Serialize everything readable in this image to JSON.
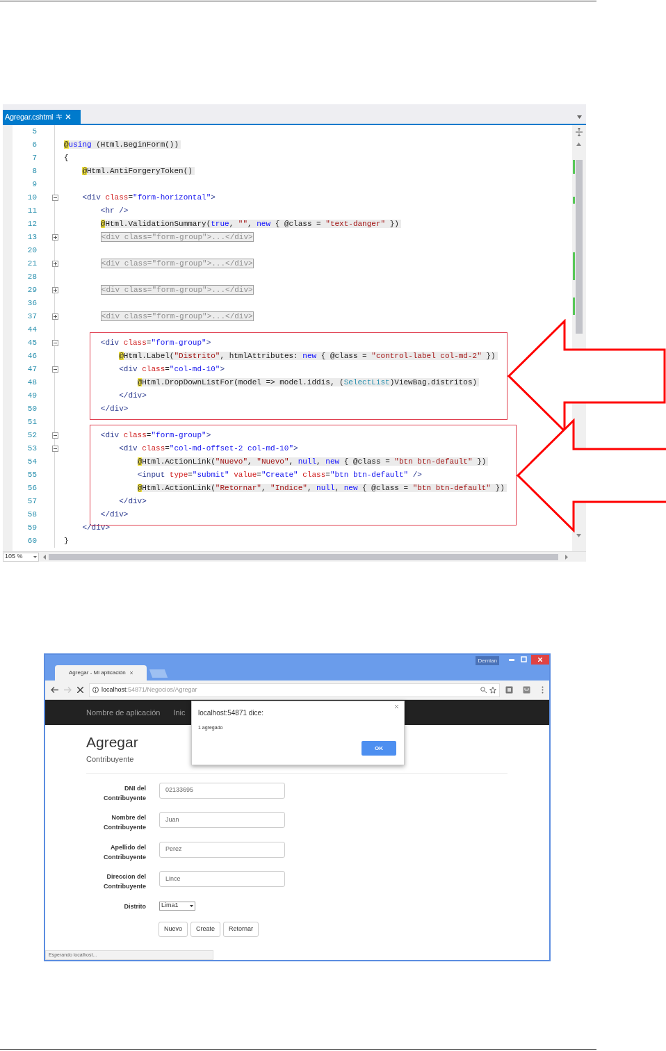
{
  "editor": {
    "tab_title": "Agregar.cshtml",
    "code_blocks": [
      {
        "lines": [
          {
            "number": "5"
          },
          {
            "number": "6",
            "razor": true,
            "tokens": [
              {
                "kind": "at",
                "text": "@"
              },
              {
                "kind": "keyword",
                "text": "using"
              },
              {
                "kind": "plain",
                "text": " (Html.BeginForm())"
              }
            ]
          },
          {
            "number": "7",
            "tokens": [
              {
                "kind": "plain",
                "text": "{"
              }
            ]
          },
          {
            "number": "8",
            "razor": true,
            "tokens": [
              {
                "kind": "at",
                "text": "    @"
              },
              {
                "kind": "plain",
                "text": "Html.AntiForgeryToken()"
              }
            ]
          },
          {
            "number": "9"
          },
          {
            "number": "10",
            "expanded": true,
            "tokens": [
              {
                "kind": "tag",
                "text": "    <div"
              },
              {
                "kind": "attr",
                "text": " class"
              },
              {
                "kind": "plain",
                "text": "="
              },
              {
                "kind": "value",
                "text": "\"form-horizontal\""
              },
              {
                "kind": "tag",
                "text": ">"
              }
            ]
          },
          {
            "number": "11",
            "tokens": [
              {
                "kind": "tag",
                "text": "        <hr />"
              }
            ]
          },
          {
            "number": "12",
            "razor": true,
            "tokens": [
              {
                "kind": "at",
                "text": "        @"
              },
              {
                "kind": "plain",
                "text": "Html.ValidationSummary("
              },
              {
                "kind": "keyword",
                "text": "true"
              },
              {
                "kind": "plain",
                "text": ", "
              },
              {
                "kind": "string",
                "text": "\"\""
              },
              {
                "kind": "plain",
                "text": ", "
              },
              {
                "kind": "keyword",
                "text": "new"
              },
              {
                "kind": "plain",
                "text": " { @class = "
              },
              {
                "kind": "string",
                "text": "\"text-danger\""
              },
              {
                "kind": "plain",
                "text": " })"
              }
            ]
          },
          {
            "number": "13",
            "expanded": false,
            "tokens": [
              {
                "kind": "collapsed",
                "text": "        <div class=\"form-group\">...</div>"
              }
            ]
          },
          {
            "number": "20"
          },
          {
            "number": "21",
            "expanded": false,
            "tokens": [
              {
                "kind": "collapsed",
                "text": "        <div class=\"form-group\">...</div>"
              }
            ]
          },
          {
            "number": "28"
          },
          {
            "number": "29",
            "expanded": false,
            "tokens": [
              {
                "kind": "collapsed",
                "text": "        <div class=\"form-group\">...</div>"
              }
            ]
          },
          {
            "number": "36"
          },
          {
            "number": "37",
            "expanded": false,
            "tokens": [
              {
                "kind": "collapsed",
                "text": "        <div class=\"form-group\">...</div>"
              }
            ]
          },
          {
            "number": "44"
          }
        ]
      },
      {
        "boxed": true,
        "lines": [
          {
            "number": "45",
            "expanded": true,
            "tokens": [
              {
                "kind": "tag",
                "text": "        <div"
              },
              {
                "kind": "attr",
                "text": " class"
              },
              {
                "kind": "plain",
                "text": "="
              },
              {
                "kind": "value",
                "text": "\"form-group\""
              },
              {
                "kind": "tag",
                "text": ">"
              }
            ]
          },
          {
            "number": "46",
            "razor": true,
            "tokens": [
              {
                "kind": "at",
                "text": "            @"
              },
              {
                "kind": "plain",
                "text": "Html.Label("
              },
              {
                "kind": "string",
                "text": "\"Distrito\""
              },
              {
                "kind": "plain",
                "text": ", htmlAttributes: "
              },
              {
                "kind": "keyword",
                "text": "new"
              },
              {
                "kind": "plain",
                "text": " { @class = "
              },
              {
                "kind": "string",
                "text": "\"control-label col-md-2\""
              },
              {
                "kind": "plain",
                "text": " })"
              }
            ]
          },
          {
            "number": "47",
            "expanded": true,
            "tokens": [
              {
                "kind": "tag",
                "text": "            <div"
              },
              {
                "kind": "attr",
                "text": " class"
              },
              {
                "kind": "plain",
                "text": "="
              },
              {
                "kind": "value",
                "text": "\"col-md-10\""
              },
              {
                "kind": "tag",
                "text": ">"
              }
            ]
          },
          {
            "number": "48",
            "razor": true,
            "tokens": [
              {
                "kind": "at",
                "text": "                @"
              },
              {
                "kind": "plain",
                "text": "Html.DropDownListFor(model => model.iddis, ("
              },
              {
                "kind": "type",
                "text": "SelectList"
              },
              {
                "kind": "plain",
                "text": ")ViewBag.distritos)"
              }
            ]
          },
          {
            "number": "49",
            "tokens": [
              {
                "kind": "tag",
                "text": "            </div>"
              }
            ]
          },
          {
            "number": "50",
            "tokens": [
              {
                "kind": "tag",
                "text": "        </div>"
              }
            ]
          }
        ]
      },
      {
        "lines": [
          {
            "number": "51"
          }
        ]
      },
      {
        "boxed": true,
        "lines": [
          {
            "number": "52",
            "expanded": true,
            "tokens": [
              {
                "kind": "tag",
                "text": "        <div"
              },
              {
                "kind": "attr",
                "text": " class"
              },
              {
                "kind": "plain",
                "text": "="
              },
              {
                "kind": "value",
                "text": "\"form-group\""
              },
              {
                "kind": "tag",
                "text": ">"
              }
            ]
          },
          {
            "number": "53",
            "expanded": true,
            "tokens": [
              {
                "kind": "tag",
                "text": "            <div"
              },
              {
                "kind": "attr",
                "text": " class"
              },
              {
                "kind": "plain",
                "text": "="
              },
              {
                "kind": "value",
                "text": "\"col-md-offset-2 col-md-10\""
              },
              {
                "kind": "tag",
                "text": ">"
              }
            ]
          },
          {
            "number": "54",
            "razor": true,
            "tokens": [
              {
                "kind": "at",
                "text": "                @"
              },
              {
                "kind": "plain",
                "text": "Html.ActionLink("
              },
              {
                "kind": "string",
                "text": "\"Nuevo\""
              },
              {
                "kind": "plain",
                "text": ", "
              },
              {
                "kind": "string",
                "text": "\"Nuevo\""
              },
              {
                "kind": "plain",
                "text": ", "
              },
              {
                "kind": "keyword",
                "text": "null"
              },
              {
                "kind": "plain",
                "text": ", "
              },
              {
                "kind": "keyword",
                "text": "new"
              },
              {
                "kind": "plain",
                "text": " { @class = "
              },
              {
                "kind": "string",
                "text": "\"btn btn-default\""
              },
              {
                "kind": "plain",
                "text": " })"
              }
            ]
          },
          {
            "number": "55",
            "tokens": [
              {
                "kind": "tag",
                "text": "                <input"
              },
              {
                "kind": "attr",
                "text": " type"
              },
              {
                "kind": "plain",
                "text": "="
              },
              {
                "kind": "value",
                "text": "\"submit\""
              },
              {
                "kind": "attr",
                "text": " value"
              },
              {
                "kind": "plain",
                "text": "="
              },
              {
                "kind": "value",
                "text": "\"Create\""
              },
              {
                "kind": "attr",
                "text": " class"
              },
              {
                "kind": "plain",
                "text": "="
              },
              {
                "kind": "value",
                "text": "\"btn btn-default\""
              },
              {
                "kind": "tag",
                "text": " />"
              }
            ]
          },
          {
            "number": "56",
            "razor": true,
            "tokens": [
              {
                "kind": "at",
                "text": "                @"
              },
              {
                "kind": "plain",
                "text": "Html.ActionLink("
              },
              {
                "kind": "string",
                "text": "\"Retornar\""
              },
              {
                "kind": "plain",
                "text": ", "
              },
              {
                "kind": "string",
                "text": "\"Indice\""
              },
              {
                "kind": "plain",
                "text": ", "
              },
              {
                "kind": "keyword",
                "text": "null"
              },
              {
                "kind": "plain",
                "text": ", "
              },
              {
                "kind": "keyword",
                "text": "new"
              },
              {
                "kind": "plain",
                "text": " { @class = "
              },
              {
                "kind": "string",
                "text": "\"btn btn-default\""
              },
              {
                "kind": "plain",
                "text": " })"
              }
            ]
          },
          {
            "number": "57",
            "tokens": [
              {
                "kind": "tag",
                "text": "            </div>"
              }
            ]
          },
          {
            "number": "58",
            "tokens": [
              {
                "kind": "tag",
                "text": "        </div>"
              }
            ]
          }
        ]
      },
      {
        "lines": [
          {
            "number": "59",
            "tokens": [
              {
                "kind": "tag",
                "text": "    </div>"
              }
            ]
          },
          {
            "number": "60",
            "tokens": [
              {
                "kind": "plain",
                "text": "}"
              }
            ]
          }
        ]
      }
    ],
    "zoom": "105 %"
  },
  "browser": {
    "tab_title": "Agregar - Mi aplicación",
    "user": "Demian",
    "url_host": "localhost",
    "url_path": ":54871/Negocios/Agregar",
    "navbar": {
      "brand": "Nombre de aplicación",
      "link": "Inic"
    },
    "page": {
      "title": "Agregar",
      "subtitle": "Contribuyente",
      "fields": [
        {
          "kind": "text",
          "label": "DNI del Contribuyente",
          "value": "02133695"
        },
        {
          "kind": "text",
          "label": "Nombre del Contribuyente",
          "value": "Juan"
        },
        {
          "kind": "text",
          "label": "Apellido del Contribuyente",
          "value": "Perez"
        },
        {
          "kind": "text",
          "label": "Direccion del Contribuyente",
          "value": "Lince"
        },
        {
          "kind": "select",
          "label": "Distrito",
          "value": "Lima1"
        }
      ],
      "buttons": [
        "Nuevo",
        "Create",
        "Retornar"
      ]
    },
    "dialog": {
      "title": "localhost:54871 dice:",
      "message": "1 agregado",
      "button": "OK"
    },
    "status": "Esperando localhost..."
  }
}
